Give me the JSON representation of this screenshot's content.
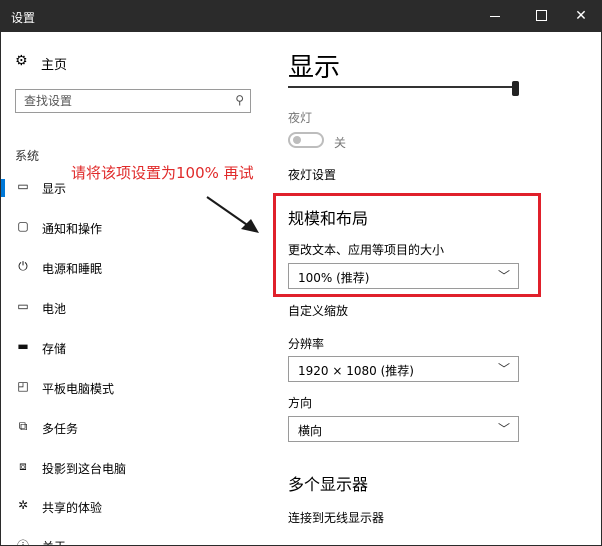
{
  "window": {
    "title": "设置"
  },
  "sidebar": {
    "home_label": "主页",
    "search_placeholder": "查找设置",
    "section_label": "系统",
    "items": [
      {
        "label": "显示",
        "icon": "monitor-icon"
      },
      {
        "label": "通知和操作",
        "icon": "notification-icon"
      },
      {
        "label": "电源和睡眠",
        "icon": "power-icon"
      },
      {
        "label": "电池",
        "icon": "battery-icon"
      },
      {
        "label": "存储",
        "icon": "storage-icon"
      },
      {
        "label": "平板电脑模式",
        "icon": "tablet-mode-icon"
      },
      {
        "label": "多任务",
        "icon": "multitasking-icon"
      },
      {
        "label": "投影到这台电脑",
        "icon": "projecting-icon"
      },
      {
        "label": "共享的体验",
        "icon": "shared-experiences-icon"
      },
      {
        "label": "关于",
        "icon": "info-icon"
      }
    ]
  },
  "annotation": {
    "text": "请将该项设置为100% 再试"
  },
  "main": {
    "title": "显示",
    "brightness_level": 1.0,
    "night_light_label": "夜灯",
    "night_light_state": "关",
    "night_light_settings_link": "夜灯设置",
    "scale_layout": {
      "heading": "规模和布局",
      "text_size_label": "更改文本、应用等项目的大小",
      "text_size_value": "100% (推荐)",
      "custom_scaling_link": "自定义缩放",
      "resolution_label": "分辨率",
      "resolution_value": "1920 × 1080 (推荐)",
      "orientation_label": "方向",
      "orientation_value": "横向"
    },
    "multiple_displays": {
      "heading": "多个显示器",
      "connect_link": "连接到无线显示器"
    }
  },
  "colors": {
    "accent": "#0078d7",
    "highlight": "#e0202b"
  }
}
